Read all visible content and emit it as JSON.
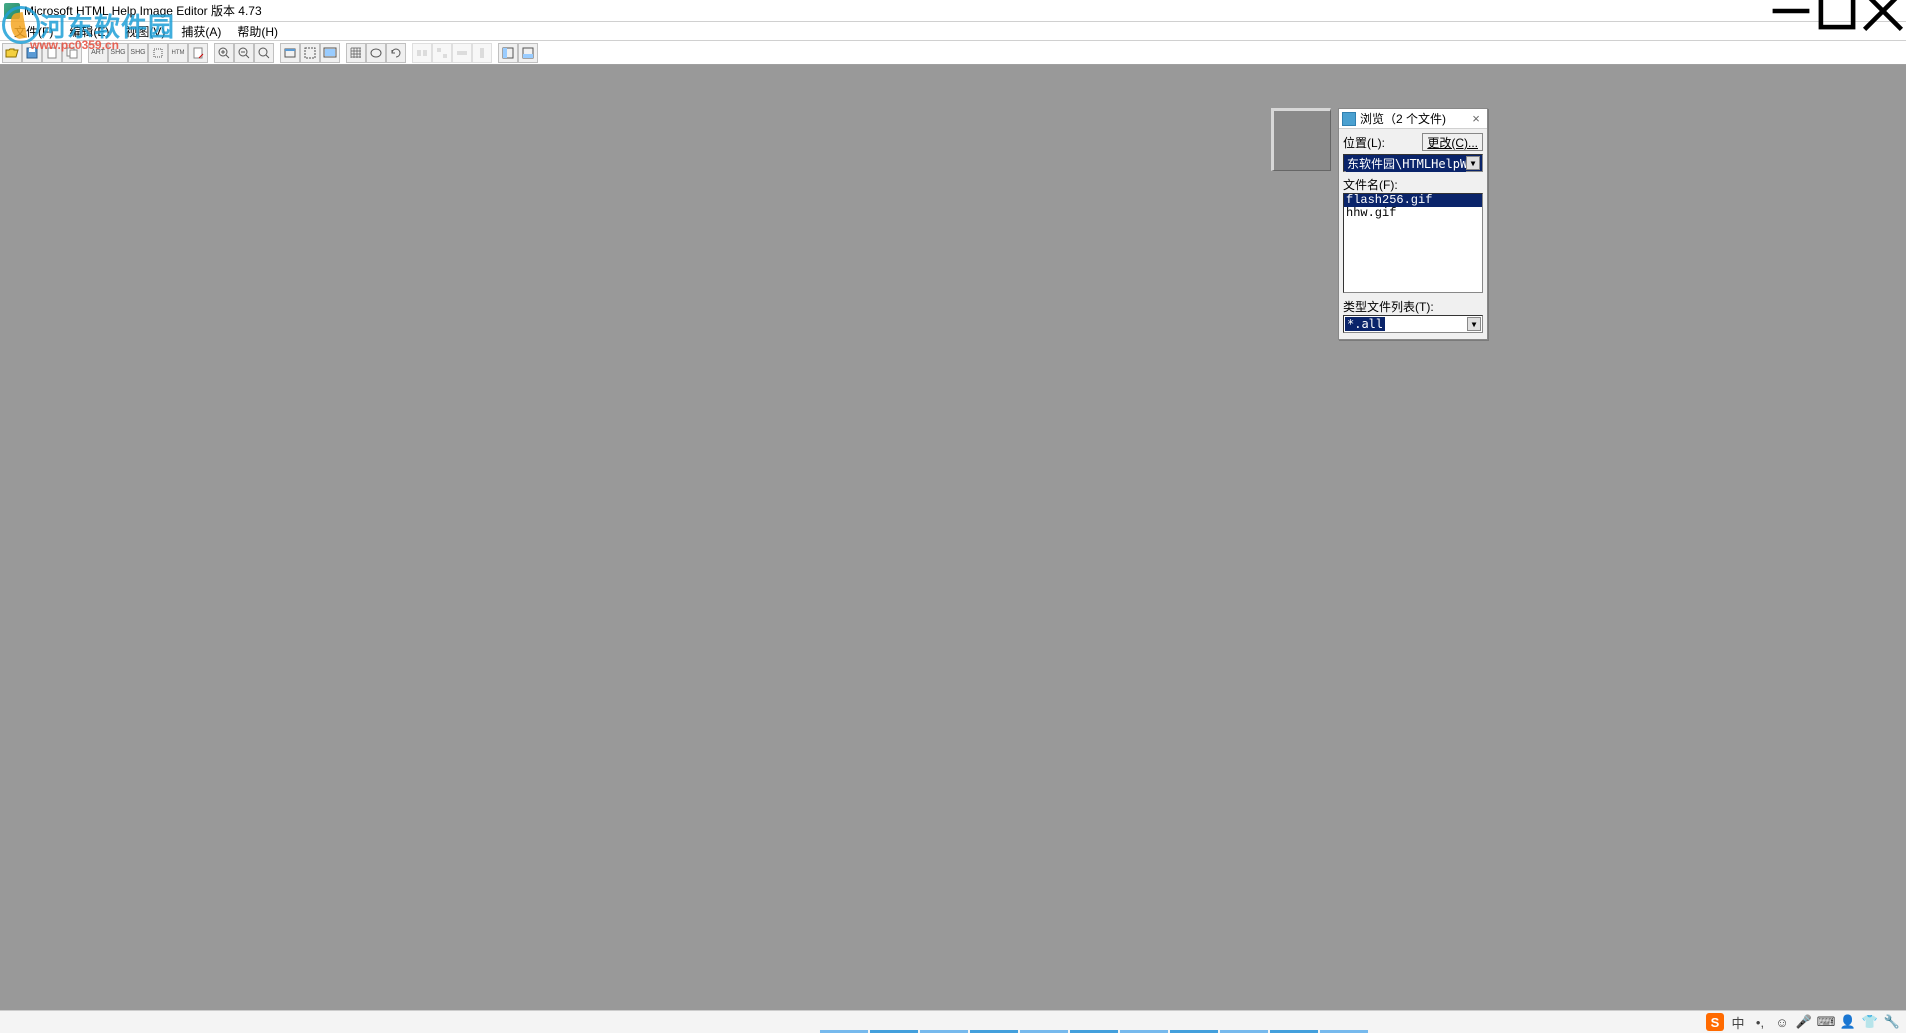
{
  "titlebar": {
    "title": "Microsoft HTML Help Image Editor 版本 4.73"
  },
  "menubar": {
    "items": [
      "文件(F)",
      "编辑(E)",
      "视图(V)",
      "捕获(A)",
      "帮助(H)"
    ]
  },
  "toolbar": {
    "groups": [
      {
        "items": [
          "open-icon",
          "save-icon",
          "new-icon",
          "copy-icon"
        ]
      },
      {
        "items": [
          "art-icon",
          "shg-icon",
          "shg2-icon",
          "clip-icon",
          "html-icon",
          "page-icon"
        ]
      },
      {
        "items": [
          "zoom-in-icon",
          "zoom-out-icon",
          "zoom-fit-icon"
        ]
      },
      {
        "items": [
          "window-icon",
          "region-icon",
          "screen-icon"
        ]
      },
      {
        "items": [
          "grid-icon",
          "oval-icon",
          "redo-icon"
        ]
      },
      {
        "items": [
          "align1-icon",
          "align2-icon",
          "align3-icon",
          "align4-icon"
        ]
      },
      {
        "items": [
          "panel1-icon",
          "panel2-icon"
        ]
      }
    ],
    "group5_disabled": true
  },
  "browse_panel": {
    "title": "浏览（2 个文件)",
    "location_label": "位置(L):",
    "change_btn": "更改(C)...",
    "location_value": "东软件园\\HTMLHelpWorkshop",
    "filename_label": "文件名(F):",
    "files": [
      {
        "name": "flash256.gif",
        "selected": true
      },
      {
        "name": "hhw.gif",
        "selected": false
      }
    ],
    "type_label": "类型文件列表(T):",
    "type_value": "*.all"
  },
  "watermark": {
    "brand": "河东软件园",
    "url": "www.pc0359.cn"
  },
  "tray": {
    "ime_text": "中"
  }
}
